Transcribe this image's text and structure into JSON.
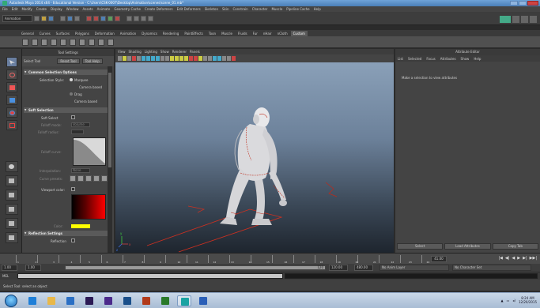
{
  "window": {
    "title": "Autodesk Maya 2014 x64 - Educational Version - C:\\Users\\CSK-0007\\Desktop\\Animation\\scenes\\scene_01.mb*"
  },
  "menu": [
    "File",
    "Edit",
    "Modify",
    "Create",
    "Display",
    "Window",
    "Assets",
    "Animate",
    "Geometry Cache",
    "Create Deformers",
    "Edit Deformers",
    "Skeleton",
    "Skin",
    "Constrain",
    "Character",
    "Muscle",
    "Pipeline Cache",
    "Help"
  ],
  "status": {
    "mode": "Animation"
  },
  "shelf": {
    "tabs": [
      "General",
      "Curves",
      "Surfaces",
      "Polygons",
      "Deformation",
      "Animation",
      "Dynamics",
      "Rendering",
      "PaintEffects",
      "Toon",
      "Muscle",
      "Fluids",
      "Fur",
      "nHair",
      "nCloth",
      "Custom"
    ],
    "active_tab": "Custom"
  },
  "tool_settings": {
    "header": "Tool Settings",
    "tool_name": "Select Tool",
    "buttons": [
      "Reset Tool",
      "Tool Help"
    ],
    "sections": {
      "common": "Common Selection Options",
      "soft": "Soft Selection",
      "reflection": "Reflection Settings"
    },
    "selection_style_label": "Selection Style:",
    "selection_style_value": "Marquee",
    "opt_camera_based": "Camera based",
    "opt_drag": "Drag",
    "opt_camera_based_2": "Camera based",
    "soft_select_label": "Soft Select",
    "falloff_mode_label": "Falloff mode:",
    "falloff_mode_value": "Volume",
    "falloff_radius_label": "Falloff radius:",
    "falloff_curve_label": "Falloff curve:",
    "interpolation_label": "Interpolation:",
    "interpolation_value": "None",
    "curve_presets_label": "Curve presets:",
    "viewport_color_label": "Viewport color:",
    "color_label": "Color:",
    "reflection_label": "Reflection"
  },
  "viewport": {
    "menu": [
      "View",
      "Shading",
      "Lighting",
      "Show",
      "Renderer",
      "Panels"
    ],
    "axis": {
      "x": "x",
      "y": "y",
      "z": "z"
    }
  },
  "attribute_editor": {
    "header": "Attribute Editor",
    "tabs": [
      "List",
      "Selected",
      "Focus",
      "Attributes",
      "Show",
      "Help"
    ],
    "message": "Make a selection to view attributes",
    "buttons": [
      "Select",
      "Load Attributes",
      "Copy Tab"
    ]
  },
  "time": {
    "ticks": [
      "1",
      "2",
      "3",
      "4",
      "5",
      "6",
      "7",
      "8",
      "9",
      "10",
      "11",
      "12",
      "13",
      "14",
      "15",
      "16",
      "17",
      "18",
      "19",
      "20",
      "21",
      "22",
      "23",
      "24"
    ],
    "current_frame": "41.00",
    "playback": [
      "|◀",
      "◀|",
      "◀",
      "▶",
      "▶|",
      "▶▶|"
    ],
    "range_start": "1.00",
    "range_inner_start": "1.00",
    "range_bar_label": "120",
    "range_inner_end": "120.00",
    "range_end": "480.00",
    "anim_layer": "No Anim Layer",
    "character_set": "No Character Set"
  },
  "command": {
    "label": "MEL"
  },
  "help_line": "Select Tool: select an object",
  "taskbar": {
    "apps": [
      {
        "name": "ie-icon",
        "color": "#1e7fd8"
      },
      {
        "name": "explorer-icon",
        "color": "#e8b84a"
      },
      {
        "name": "media-player-icon",
        "color": "#2a6fc4"
      },
      {
        "name": "premiere-icon",
        "color": "#2b1a55"
      },
      {
        "name": "premiere-pro-icon",
        "color": "#4b2a8b"
      },
      {
        "name": "photoshop-icon",
        "color": "#1a4f8a"
      },
      {
        "name": "illustrator-icon",
        "color": "#b23a1a"
      },
      {
        "name": "dreamweaver-icon",
        "color": "#2a7a2a"
      },
      {
        "name": "maya-icon",
        "color": "#1aa3a3"
      },
      {
        "name": "word-icon",
        "color": "#2a5fb8"
      }
    ],
    "time": "8:24 AM",
    "date": "12/20/2015"
  }
}
